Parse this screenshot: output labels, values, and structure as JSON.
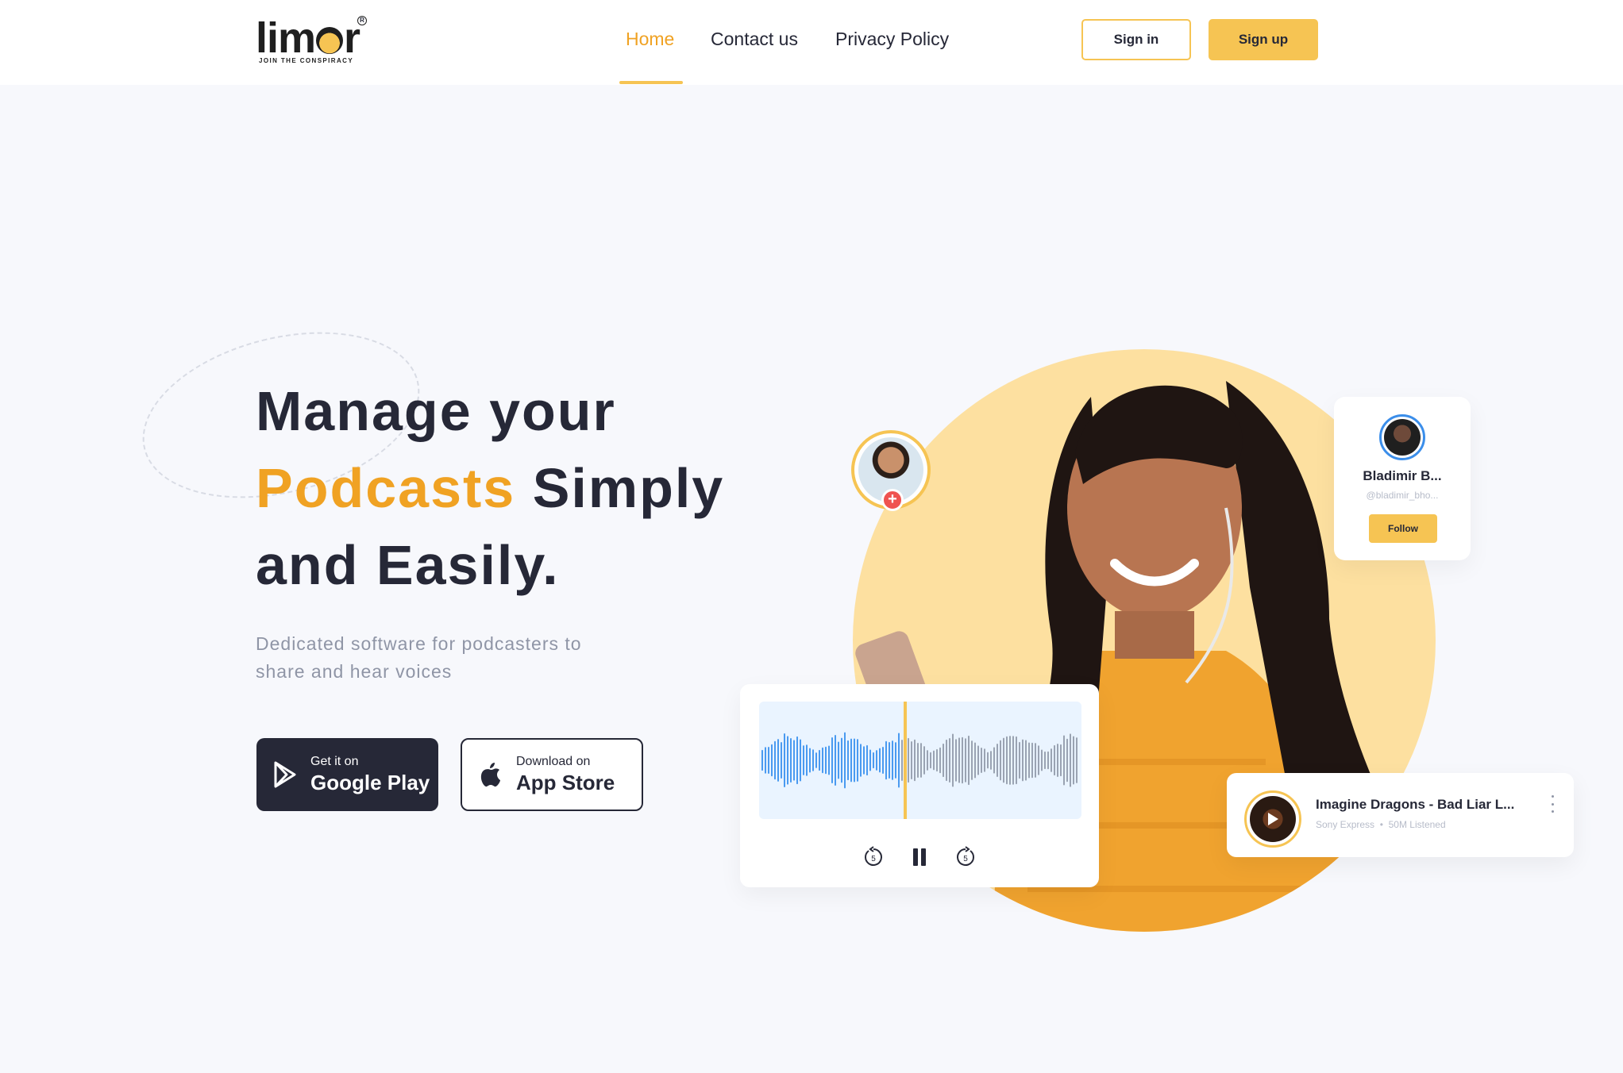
{
  "brand": {
    "name": "limor",
    "tagline": "JOIN THE CONSPIRACY",
    "registered_mark": "R",
    "accent_color": "#F6C453",
    "accent_text_color": "#F0A223",
    "dark_color": "#262837"
  },
  "nav": {
    "items": [
      {
        "label": "Home",
        "active": true
      },
      {
        "label": "Contact us",
        "active": false
      },
      {
        "label": "Privacy Policy",
        "active": false
      }
    ]
  },
  "auth": {
    "sign_in": "Sign in",
    "sign_up": "Sign up"
  },
  "hero": {
    "headline_line1": "Manage your",
    "headline_accent": "Podcasts",
    "headline_line2_rest": " Simply",
    "headline_line3": "and Easily.",
    "subtext": "Dedicated software for podcasters to share and hear voices"
  },
  "stores": {
    "google": {
      "small": "Get it on",
      "big": "Google Play",
      "icon": "play-store-icon"
    },
    "apple": {
      "small": "Download on",
      "big": "App Store",
      "icon": "apple-icon"
    }
  },
  "follow_card": {
    "name": "Bladimir B...",
    "handle": "@bladimir_bho...",
    "button": "Follow"
  },
  "avatar_badge": {
    "icon": "plus-icon",
    "symbol": "+"
  },
  "player": {
    "controls": [
      "rewind-5-icon",
      "pause-icon",
      "forward-5-icon"
    ],
    "skip_seconds": "5",
    "progress": 0.44
  },
  "track": {
    "title": "Imagine Dragons - Bad Liar L...",
    "artist": "Sony Express",
    "separator": "•",
    "listens": "50M Listened",
    "icon": "play-icon"
  }
}
